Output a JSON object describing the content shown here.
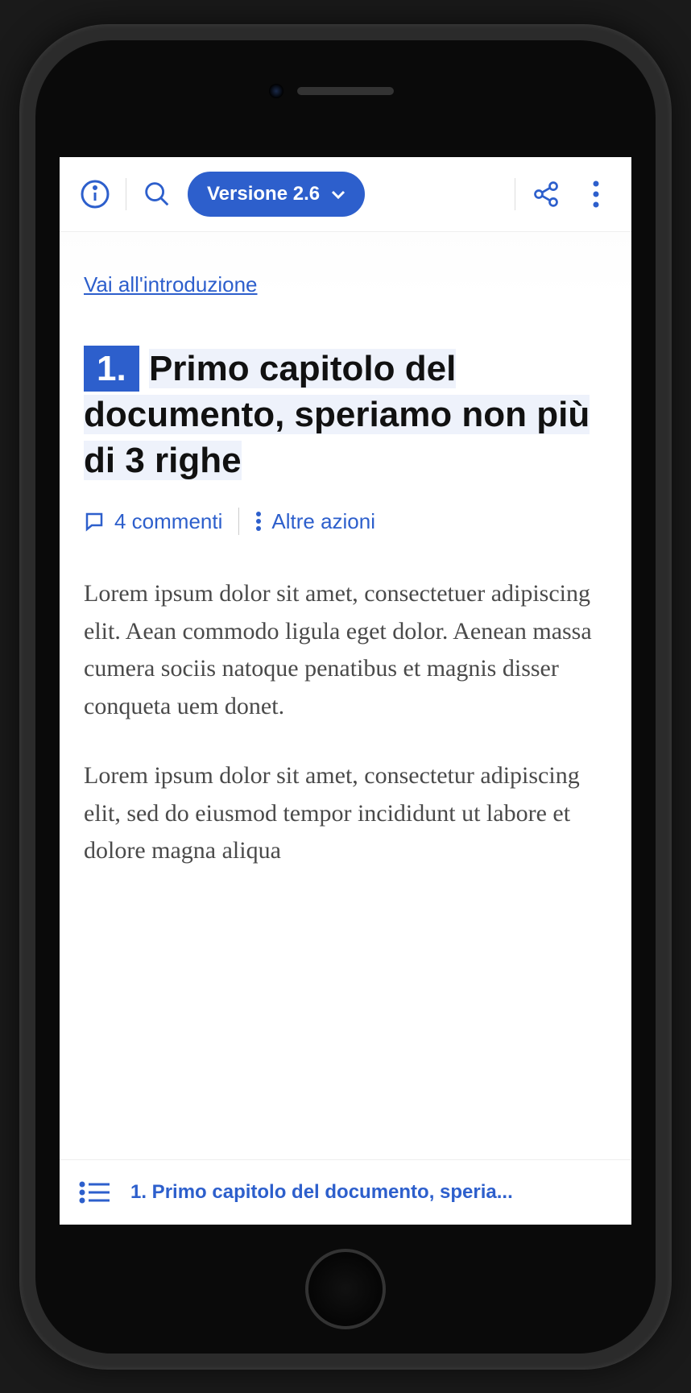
{
  "toolbar": {
    "version_label": "Versione 2.6"
  },
  "content": {
    "intro_link": "Vai all'introduzione",
    "chapter_number": "1.",
    "chapter_title": "Primo capitolo del documento, speriamo non più di 3 righe",
    "comments_label": "4 commenti",
    "more_actions": "Altre azioni",
    "paragraph1": "Lorem ipsum dolor sit amet, consectetuer adipiscing elit. Aean commodo ligula eget dolor. Aenean massa cumera sociis natoque penatibus et magnis disser conqueta uem donet.",
    "paragraph2": "Lorem ipsum dolor sit amet, consectetur adipiscing elit, sed do eiusmod tempor incididunt ut labore et dolore magna aliqua"
  },
  "bottom": {
    "breadcrumb": "1. Primo capitolo del documento, speria..."
  }
}
